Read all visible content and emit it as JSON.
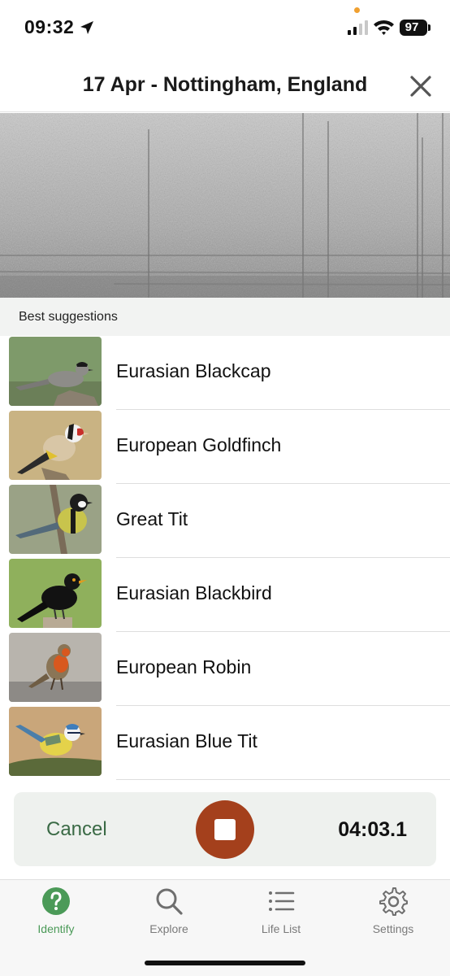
{
  "status_bar": {
    "time": "09:32",
    "battery": "97",
    "icons": [
      "location-arrow-icon",
      "signal-icon",
      "wifi-icon",
      "battery-icon"
    ]
  },
  "header": {
    "title": "17 Apr - Nottingham, England",
    "close_icon": "close-icon"
  },
  "section": {
    "label": "Best suggestions"
  },
  "suggestions": [
    {
      "name": "Eurasian Blackcap"
    },
    {
      "name": "European Goldfinch"
    },
    {
      "name": "Great Tit"
    },
    {
      "name": "Eurasian Blackbird"
    },
    {
      "name": "European Robin"
    },
    {
      "name": "Eurasian Blue Tit"
    }
  ],
  "recording": {
    "cancel_label": "Cancel",
    "timer": "04:03.1",
    "stop_color": "#a4401c"
  },
  "tabs": [
    {
      "label": "Identify",
      "icon": "question-icon",
      "active": true
    },
    {
      "label": "Explore",
      "icon": "search-icon",
      "active": false
    },
    {
      "label": "Life List",
      "icon": "list-icon",
      "active": false
    },
    {
      "label": "Settings",
      "icon": "gear-icon",
      "active": false
    }
  ],
  "colors": {
    "accent": "#4b9a58",
    "cancel_text": "#3a6a45",
    "record_bar_bg": "#eef1ee"
  }
}
